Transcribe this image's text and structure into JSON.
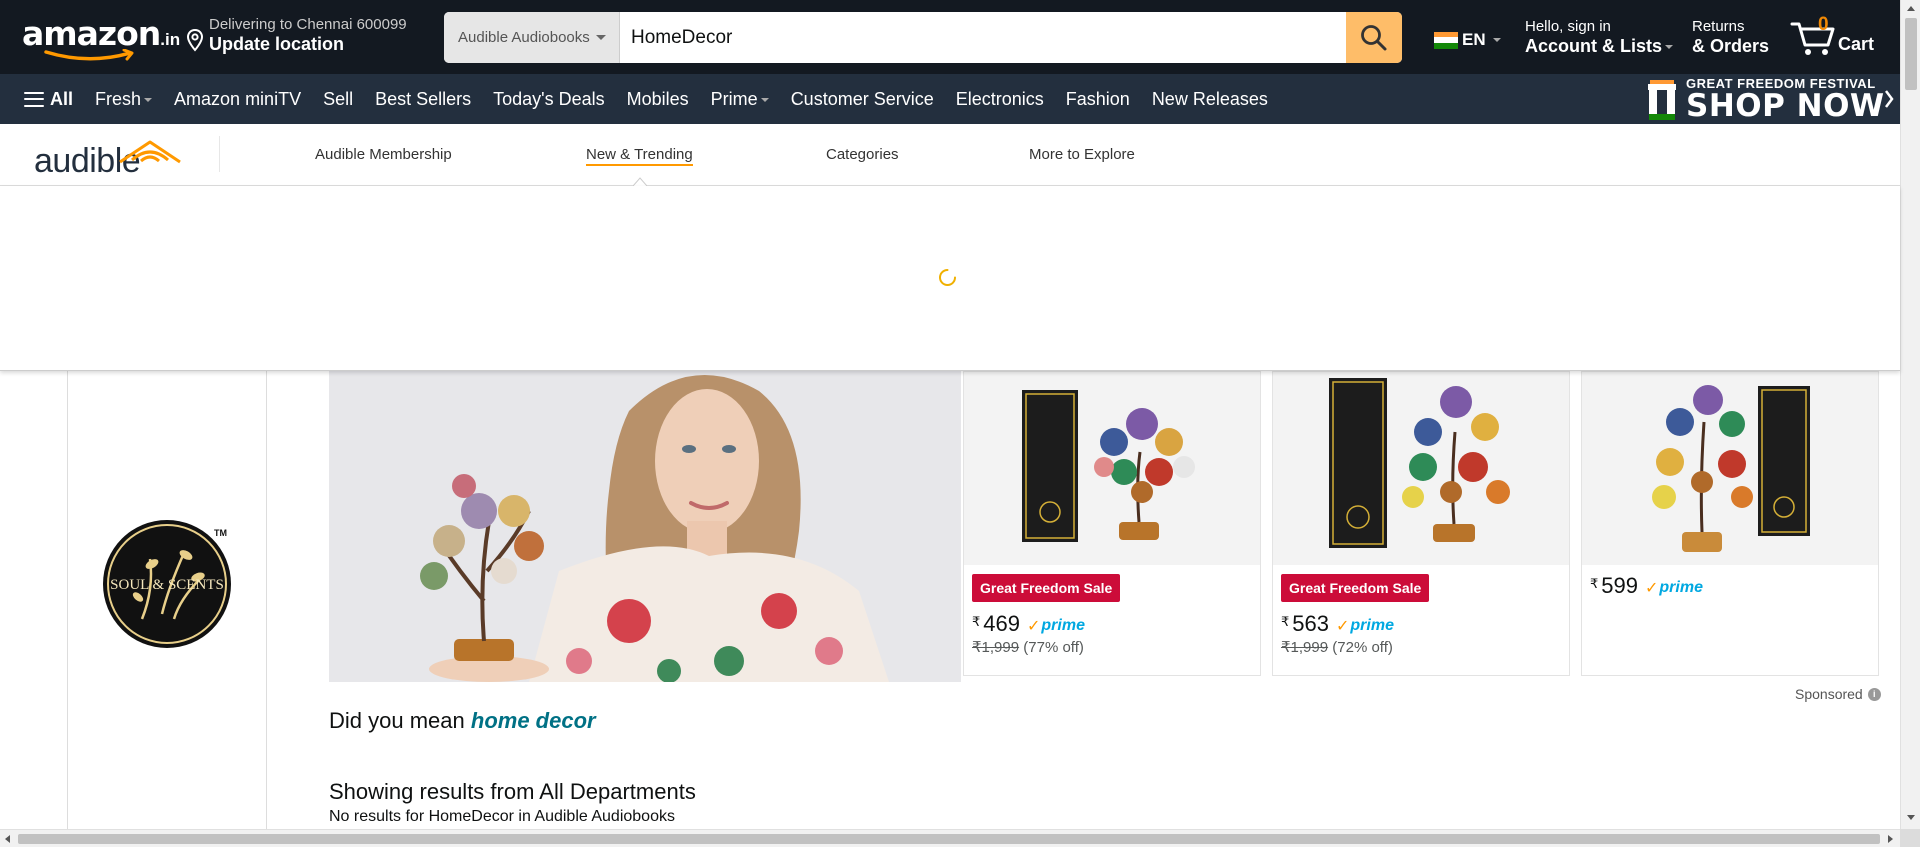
{
  "header": {
    "logo_text": "amazon",
    "logo_tld": ".in",
    "deliver_line1": "Delivering to Chennai 600099",
    "deliver_line2": "Update location",
    "search_category": "Audible Audiobooks",
    "search_value": "HomeDecor",
    "language": "EN",
    "account_line1": "Hello, sign in",
    "account_line2": "Account & Lists",
    "returns_line1": "Returns",
    "returns_line2": "& Orders",
    "cart_count": "0",
    "cart_label": "Cart"
  },
  "nav": {
    "all_label": "All",
    "links": [
      "Fresh",
      "Amazon miniTV",
      "Sell",
      "Best Sellers",
      "Today's Deals",
      "Mobiles",
      "Prime",
      "Customer Service",
      "Electronics",
      "Fashion",
      "New Releases"
    ],
    "promo_line1": "GREAT FREEDOM FESTIVAL",
    "promo_line2": "SHOP NOW"
  },
  "audible": {
    "logo_text": "audible",
    "tabs": [
      "Audible Membership",
      "New & Trending",
      "Categories",
      "More to Explore"
    ],
    "active_tab": "New & Trending"
  },
  "sponsored_ad": {
    "brand_line": "SOUL & SCENTS",
    "tm": "TM",
    "products": [
      {
        "badge": "Great Freedom Sale",
        "currency": "₹",
        "price": "469",
        "prime": "prime",
        "mrp": "₹1,999",
        "discount": "(77% off)"
      },
      {
        "badge": "Great Freedom Sale",
        "currency": "₹",
        "price": "563",
        "prime": "prime",
        "mrp": "₹1,999",
        "discount": "(72% off)"
      },
      {
        "badge": "",
        "currency": "₹",
        "price": "599",
        "prime": "prime",
        "mrp": "",
        "discount": ""
      }
    ],
    "sponsored_label": "Sponsored",
    "info_icon": "i"
  },
  "results": {
    "did_you_mean_prefix": "Did you mean",
    "did_you_mean_term": "home decor",
    "showing": "Showing results from All Departments",
    "no_results": "No results for HomeDecor in Audible Audiobooks"
  },
  "colors": {
    "nav_top": "#131921",
    "nav_main": "#232f3e",
    "search_button": "#febd69",
    "sale_badge": "#cc0c39",
    "accent_orange": "#ff9900",
    "link_teal": "#007185"
  }
}
